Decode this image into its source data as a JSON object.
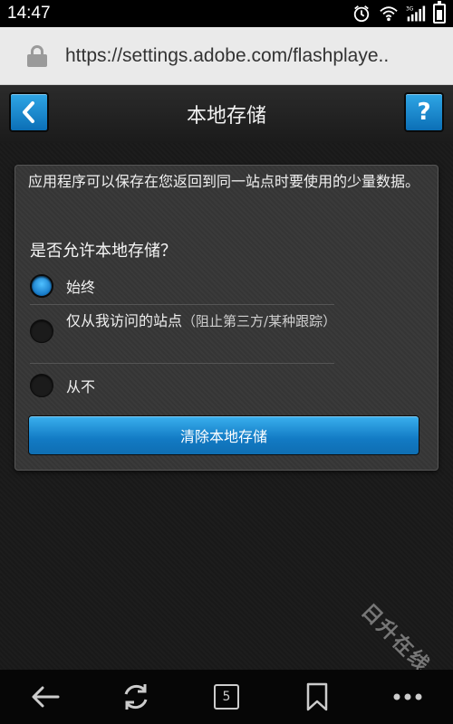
{
  "status_bar": {
    "time": "14:47"
  },
  "browser": {
    "url": "https://settings.adobe.com/flashplaye.."
  },
  "header": {
    "title": "本地存储",
    "back_icon": "‹",
    "help_icon": "?"
  },
  "panel": {
    "description": "应用程序可以保存在您返回到同一站点时要使用的少量数据。",
    "question": "是否允许本地存储？",
    "options": [
      {
        "label": "始终",
        "note": "",
        "selected": true
      },
      {
        "label": "仅从我访问的站点",
        "note": "（阻止第三方/某种跟踪）",
        "selected": false
      },
      {
        "label": "从不",
        "note": "",
        "selected": false
      }
    ],
    "clear_button": "清除本地存储"
  },
  "nav": {
    "tabs_count": "5"
  },
  "watermark": "日升在线"
}
